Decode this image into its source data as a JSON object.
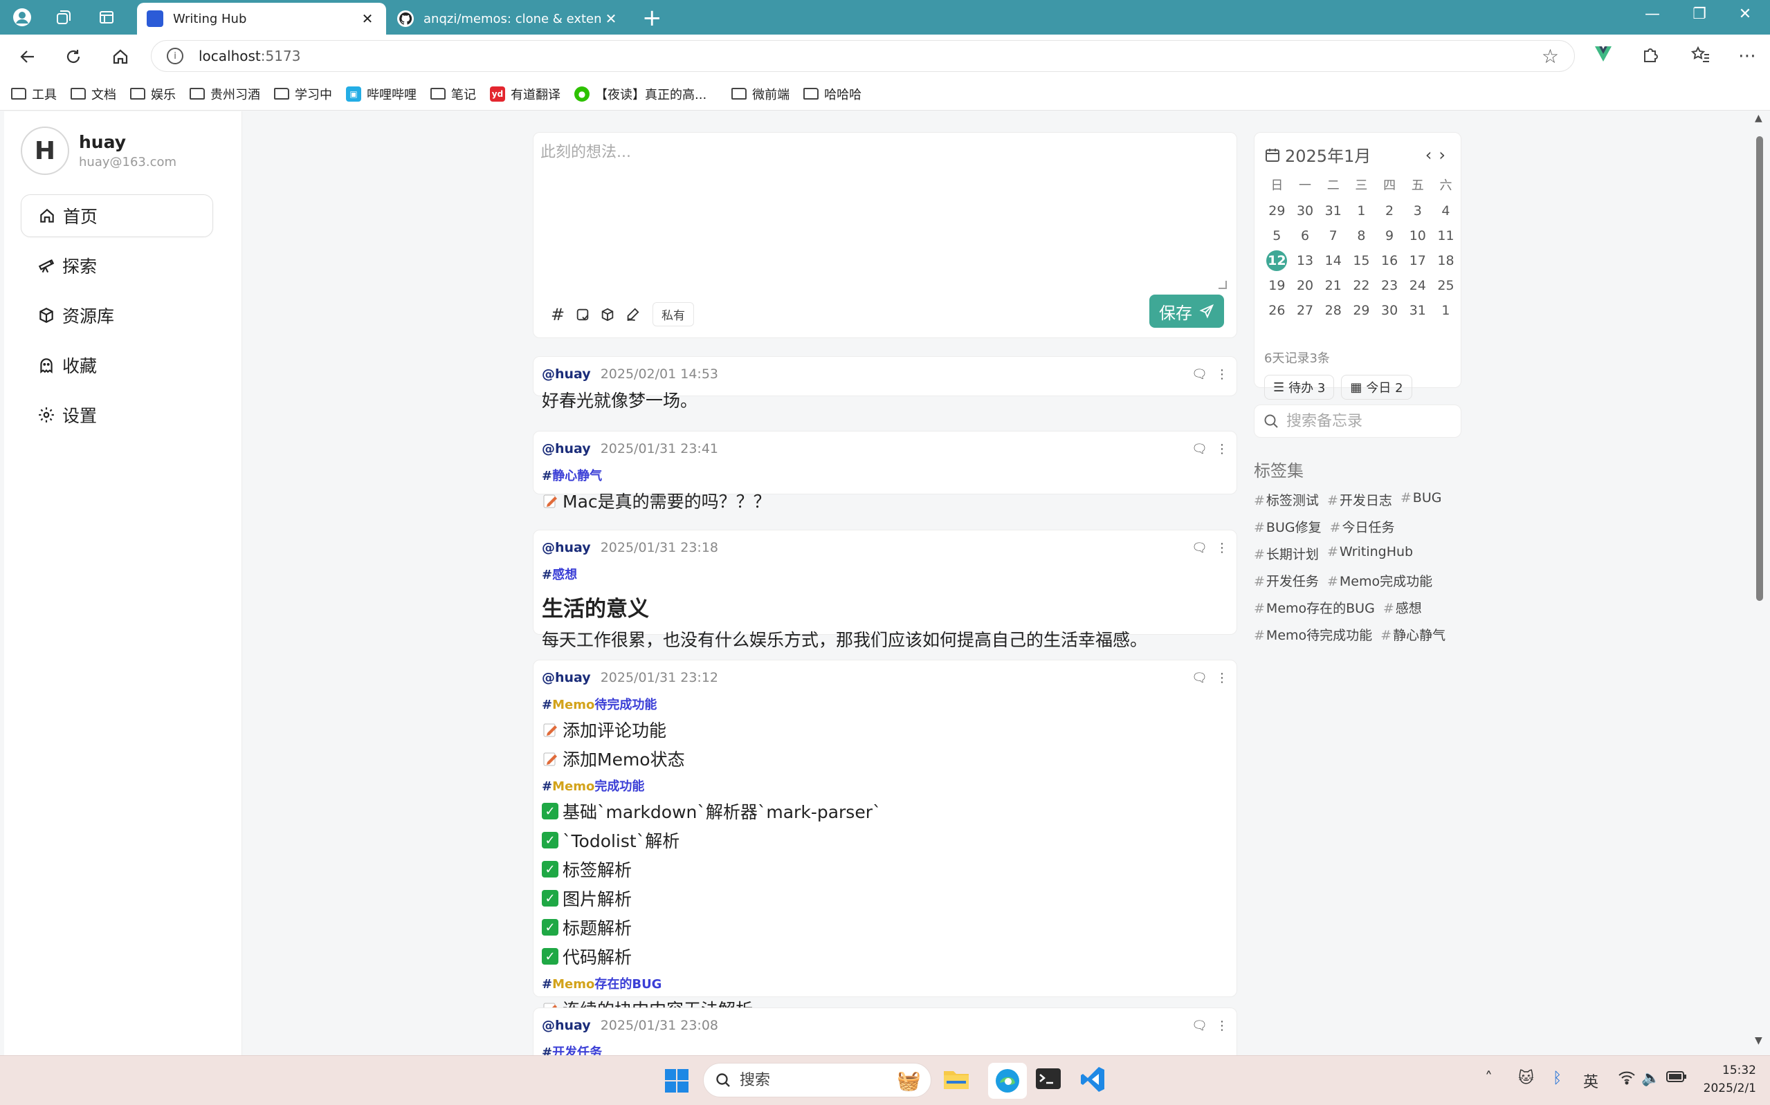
{
  "browser": {
    "tabs": [
      {
        "title": "Writing Hub"
      },
      {
        "title": "anqzi/memos: clone & extend usememos"
      }
    ],
    "url_host": "localhost",
    "url_port": ":5173",
    "bookmarks": [
      {
        "label": "工具",
        "icon": "folder-icon"
      },
      {
        "label": "文档",
        "icon": "folder-icon"
      },
      {
        "label": "娱乐",
        "icon": "folder-icon"
      },
      {
        "label": "贵州习酒",
        "icon": "folder-icon"
      },
      {
        "label": "学习中",
        "icon": "folder-icon"
      },
      {
        "label": "哔哩哔哩",
        "icon": "bilibili-icon"
      },
      {
        "label": "笔记",
        "icon": "folder-icon"
      },
      {
        "label": "有道翻译",
        "icon": "youdao-icon"
      },
      {
        "label": "【夜读】真正的高...",
        "icon": "wechat-icon"
      },
      {
        "label": "微前端",
        "icon": "folder-icon"
      },
      {
        "label": "哈哈哈",
        "icon": "folder-icon"
      }
    ],
    "youdao_badge": "yd"
  },
  "user": {
    "initial": "H",
    "name": "huay",
    "email": "huay@163.com"
  },
  "menu": [
    {
      "label": "首页",
      "icon": "home-icon",
      "active": true
    },
    {
      "label": "探索",
      "icon": "telescope-icon"
    },
    {
      "label": "资源库",
      "icon": "box-icon"
    },
    {
      "label": "收藏",
      "icon": "ghost-icon"
    },
    {
      "label": "设置",
      "icon": "gear-icon"
    }
  ],
  "editor": {
    "placeholder": "此刻的想法...",
    "private_label": "私有",
    "save_label": "保存",
    "hash_symbol": "#"
  },
  "memos": [
    {
      "author": "@huay",
      "time": "2025/02/01 14:53",
      "blocks": [
        {
          "type": "text",
          "text": "好春光就像梦一场。"
        }
      ]
    },
    {
      "author": "@huay",
      "time": "2025/01/31 23:41",
      "blocks": [
        {
          "type": "tag",
          "text": "静心静气"
        },
        {
          "type": "todo",
          "text": "Mac是真的需要的吗？？？"
        }
      ]
    },
    {
      "author": "@huay",
      "time": "2025/01/31 23:18",
      "blocks": [
        {
          "type": "tag",
          "text": "感想"
        },
        {
          "type": "heading",
          "text": "生活的意义"
        },
        {
          "type": "text",
          "text": "每天工作很累，也没有什么娱乐方式，那我们应该如何提高自己的生活幸福感。"
        }
      ]
    },
    {
      "author": "@huay",
      "time": "2025/01/31 23:12",
      "blocks": [
        {
          "type": "tag",
          "text": "Memo待完成功能"
        },
        {
          "type": "todo",
          "text": "添加评论功能"
        },
        {
          "type": "todo",
          "text": "添加Memo状态"
        },
        {
          "type": "tag",
          "text": "Memo完成功能"
        },
        {
          "type": "done",
          "text": "基础`markdown`解析器`mark-parser`"
        },
        {
          "type": "done",
          "text": "`Todolist`解析"
        },
        {
          "type": "done",
          "text": "标签解析"
        },
        {
          "type": "done",
          "text": "图片解析"
        },
        {
          "type": "done",
          "text": "标题解析"
        },
        {
          "type": "done",
          "text": "代码解析"
        },
        {
          "type": "tag",
          "text": "Memo存在的BUG"
        },
        {
          "type": "todo",
          "text": "连续的块内内容无法解析"
        }
      ]
    },
    {
      "author": "@huay",
      "time": "2025/01/31 23:08",
      "blocks": [
        {
          "type": "tag",
          "text": "开发任务"
        }
      ]
    }
  ],
  "calendar": {
    "title": "2025年1月",
    "weekdays": [
      "日",
      "一",
      "二",
      "三",
      "四",
      "五",
      "六"
    ],
    "days": [
      "29",
      "30",
      "31",
      "1",
      "2",
      "3",
      "4",
      "5",
      "6",
      "7",
      "8",
      "9",
      "10",
      "11",
      "12",
      "13",
      "14",
      "15",
      "16",
      "17",
      "18",
      "19",
      "20",
      "21",
      "22",
      "23",
      "24",
      "25",
      "26",
      "27",
      "28",
      "29",
      "30",
      "31",
      "1"
    ],
    "today": "12",
    "summary": "6天记录3条",
    "todo_chip": "待办 3",
    "today_chip": "今日 2"
  },
  "search": {
    "placeholder": "搜索备忘录"
  },
  "tag_section": {
    "title": "标签集",
    "tags": [
      "标签测试",
      "开发日志",
      "BUG",
      "BUG修复",
      "今日任务",
      "长期计划",
      "WritingHub",
      "开发任务",
      "Memo完成功能",
      "Memo存在的BUG",
      "感想",
      "Memo待完成功能",
      "静心静气"
    ]
  },
  "taskbar": {
    "search_placeholder": "搜索",
    "ime": "英",
    "time": "15:32",
    "date": "2025/2/1"
  },
  "colors": {
    "tab_bar": "#3e97a7",
    "accent": "#3fa896",
    "author": "#1b2d7a",
    "tag_gold": "#d3a31b",
    "tag_blue": "#3b3fd6",
    "check": "#1fa845"
  }
}
